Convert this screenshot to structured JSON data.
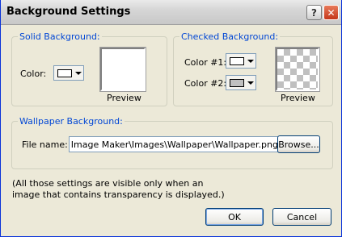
{
  "window": {
    "title": "Background Settings",
    "help_glyph": "?",
    "close_glyph": "✕"
  },
  "solid": {
    "legend": "Solid Background:",
    "color_label": "Color:",
    "color_swatch": "#ffffff",
    "preview_label": "Preview"
  },
  "checked": {
    "legend": "Checked Background:",
    "color1_label": "Color #1:",
    "color2_label": "Color #2:",
    "color1_swatch": "#ffffff",
    "color2_swatch": "#c0c0c0",
    "preview_label": "Preview"
  },
  "wallpaper": {
    "legend": "Wallpaper Background:",
    "file_label": "File name:",
    "file_value": "eo Image Maker\\Images\\Wallpaper\\Wallpaper.png",
    "browse_label": "Browse..."
  },
  "note_line1": "(All those settings are visible only when an",
  "note_line2": "image that contains transparency is displayed.)",
  "buttons": {
    "ok": "OK",
    "cancel": "Cancel"
  }
}
